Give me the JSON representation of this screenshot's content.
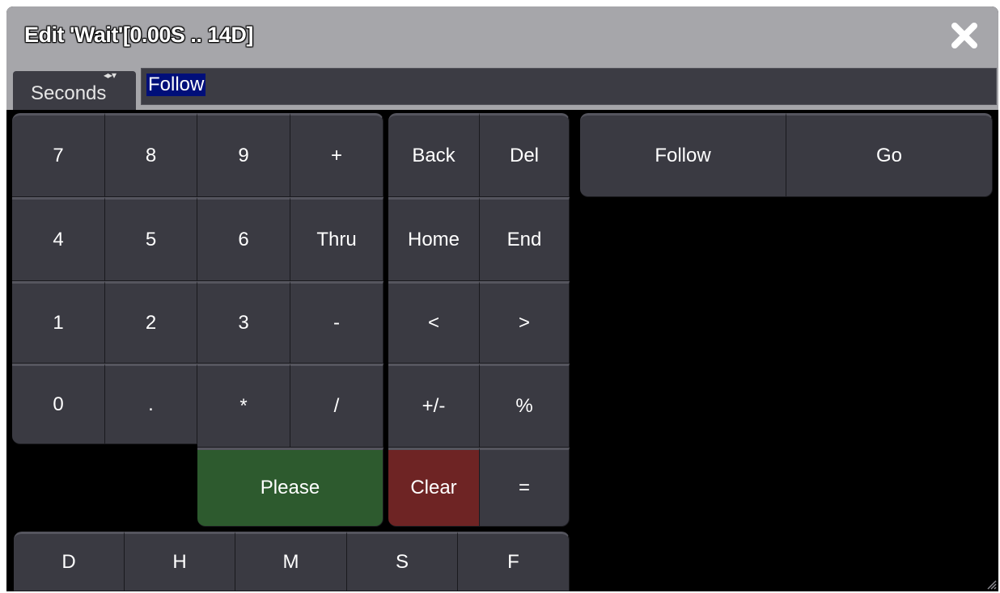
{
  "window": {
    "title": "Edit 'Wait'[0.00S .. 14D]",
    "close_icon": "close-icon"
  },
  "input": {
    "unit_label": "Seconds",
    "unit_arrows": "◂▸▾",
    "value": "Follow"
  },
  "numpad": {
    "row1": [
      "7",
      "8",
      "9",
      "+"
    ],
    "row2": [
      "4",
      "5",
      "6",
      "Thru"
    ],
    "row3": [
      "1",
      "2",
      "3",
      "-"
    ],
    "row4": [
      "0",
      ".",
      "*",
      "/"
    ]
  },
  "editpad": {
    "row1": [
      "Back",
      "Del"
    ],
    "row2": [
      "Home",
      "End"
    ],
    "row3": [
      "<",
      ">"
    ],
    "row4": [
      "+/-",
      "%"
    ],
    "row5": [
      "Clear",
      "="
    ]
  },
  "please_label": "Please",
  "units": [
    "D",
    "H",
    "M",
    "S",
    "F"
  ],
  "quick": [
    "Follow",
    "Go"
  ],
  "colors": {
    "titlebar": "#a6a6aa",
    "button": "#3a3a42",
    "please": "#2d5a2e",
    "clear": "#6e2424",
    "selection": "#000f7a"
  }
}
